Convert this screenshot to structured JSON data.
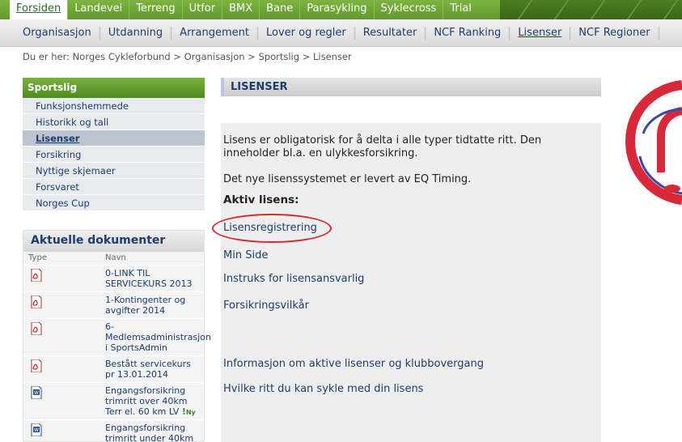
{
  "top_tabs": [
    "Forsiden",
    "Landevei",
    "Terreng",
    "Utfor",
    "BMX",
    "Bane",
    "Parasykling",
    "Syklecross",
    "Trial"
  ],
  "sub_tabs": [
    "Organisasjon",
    "Utdanning",
    "Arrangement",
    "Lover og regler",
    "Resultater",
    "NCF Ranking",
    "Lisenser",
    "NCF Regioner"
  ],
  "breadcrumb": "Du er her: Norges Cykleforbund > Organisasjon > Sportslig > Lisenser",
  "sidebar": {
    "heading": "Sportslig",
    "items": [
      "Funksjonshemmede",
      "Historikk og tall",
      "Lisenser",
      "Forsikring",
      "Nyttige skjemaer",
      "Forsvaret",
      "Norges Cup"
    ]
  },
  "documents": {
    "title": "Aktuelle dokumenter",
    "col_type": "Type",
    "col_name": "Navn",
    "rows": [
      {
        "name": "0-LINK TIL SERVICEKURS 2013",
        "icon": "pdf-icon",
        "badge": ""
      },
      {
        "name": "1-Kontingenter og avgifter 2014",
        "icon": "pdf-icon",
        "badge": ""
      },
      {
        "name": "6-Medlemsadministrasjon i SportsAdmin",
        "icon": "pdf-icon",
        "badge": ""
      },
      {
        "name": "Bestått servicekurs pr 13.01.2014",
        "icon": "pdf-icon",
        "badge": ""
      },
      {
        "name": "Engangsforsikring trimritt over 40km Terr el. 60 km LV",
        "icon": "word-icon",
        "badge": "Ny"
      },
      {
        "name": "Engangsforsikring trimritt under 40km",
        "icon": "word-icon",
        "badge": ""
      }
    ]
  },
  "main": {
    "title": "LISENSER",
    "intro": "Lisens er obligatorisk for å delta i alle typer tidtatte ritt. Den inneholder bl.a. en ulykkesforsikring.",
    "system_note": "Det nye lisenssystemet er levert av EQ Timing.",
    "active_heading": "Aktiv lisens:",
    "links": [
      "Lisensregistrering",
      "Min Side",
      "Instruks for lisensansvarlig",
      "Forsikringsvilkår",
      "Informasjon om aktive lisenser og klubbovergang",
      "Hvilke ritt du kan  sykle med din lisens"
    ]
  },
  "colors": {
    "green": "#5f9a2b",
    "navy": "#1d3d6e",
    "highlight_red": "#d8282e"
  }
}
